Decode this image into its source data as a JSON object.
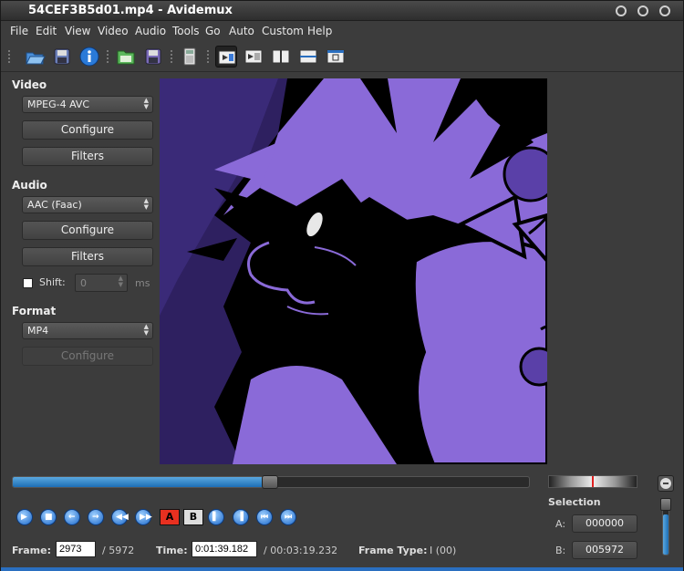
{
  "window": {
    "title": "54CEF3B5d01.mp4 - Avidemux"
  },
  "menu": {
    "items": [
      "File",
      "Edit",
      "View",
      "Video",
      "Audio",
      "Tools",
      "Go",
      "Auto",
      "Custom",
      "Help"
    ]
  },
  "video": {
    "section_label": "Video",
    "codec": "MPEG-4 AVC",
    "configure_label": "Configure",
    "filters_label": "Filters"
  },
  "audio": {
    "section_label": "Audio",
    "codec": "AAC (Faac)",
    "configure_label": "Configure",
    "filters_label": "Filters",
    "shift_label": "Shift:",
    "shift_value": "0",
    "shift_unit": "ms"
  },
  "format": {
    "section_label": "Format",
    "container": "MP4",
    "configure_label": "Configure"
  },
  "navigation": {
    "seek_position": 0.498,
    "volume_level": 0.75,
    "a_marker_label": "A",
    "b_marker_label": "B"
  },
  "status": {
    "frame_label": "Frame:",
    "frame_value": "2973",
    "frame_total": "/ 5972",
    "time_label": "Time:",
    "time_value": "0:01:39.182",
    "time_total": "/ 00:03:19.232",
    "frame_type_label": "Frame Type:",
    "frame_type_value": "I (00)"
  },
  "selection": {
    "label": "Selection",
    "a_label": "A:",
    "a_value": "000000",
    "b_label": "B:",
    "b_value": "005972"
  },
  "colors": {
    "accent": "#1d6eb5",
    "preview_bg": "#2e2060",
    "character": "#8a6ad8"
  }
}
